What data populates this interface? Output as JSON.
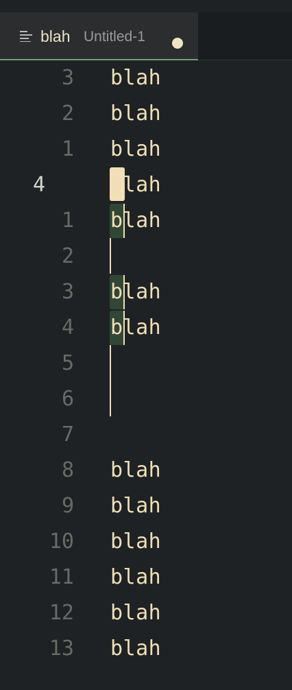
{
  "tab": {
    "title": "blah",
    "description": "Untitled-1",
    "icon": "list-icon",
    "dirty": true
  },
  "editor": {
    "lines": [
      {
        "number": "3",
        "text": "blah"
      },
      {
        "number": "2",
        "text": "blah"
      },
      {
        "number": "1",
        "text": "blah"
      },
      {
        "number": "4",
        "text": "blah",
        "current": true
      },
      {
        "number": "1",
        "text": "blah"
      },
      {
        "number": "2",
        "text": ""
      },
      {
        "number": "3",
        "text": "blah"
      },
      {
        "number": "4",
        "text": "blah"
      },
      {
        "number": "5",
        "text": ""
      },
      {
        "number": "6",
        "text": ""
      },
      {
        "number": "7",
        "text": ""
      },
      {
        "number": "8",
        "text": "blah"
      },
      {
        "number": "9",
        "text": "blah"
      },
      {
        "number": "10",
        "text": "blah"
      },
      {
        "number": "11",
        "text": "blah"
      },
      {
        "number": "12",
        "text": "blah"
      },
      {
        "number": "13",
        "text": "blah"
      }
    ]
  },
  "colors": {
    "background": "#1e2224",
    "text": "#efdfb7",
    "line_number": "#6a6a66",
    "current_line_number": "#d4d3cf",
    "primary_selection": "#f2dfb7",
    "secondary_selection": "#324636",
    "tab_active_border": "#6fa07a"
  }
}
